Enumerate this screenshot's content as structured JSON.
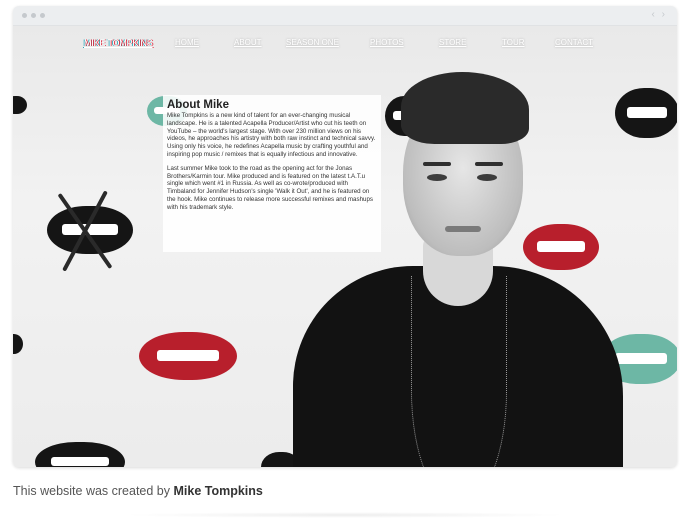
{
  "nav": {
    "logo": "MIKE TOMPKINS",
    "items": [
      "HOME",
      "ABOUT",
      "SEASON ONE",
      "PHOTOS",
      "STORE",
      "TOUR",
      "CONTACT"
    ]
  },
  "about": {
    "title": "About Mike",
    "paragraph1": "Mike Tompkins is a new kind of talent for an ever-changing musical landscape. He is a talented Acapella Producer/Artist who cut his teeth on YouTube – the world's largest stage. With over 230 million views on his videos, he approaches his artistry with both raw instinct and technical savvy. Using only his voice, he redefines Acapella music by crafting youthful and inspiring pop music / remixes that is equally infectious and innovative.",
    "paragraph2": "Last summer Mike took to the road as the opening act for the Jonas Brothers/Karmin tour. Mike produced and is featured on the latest t.A.T.u single which went #1 in Russia. As well as co-wrote/produced with Timbaland for Jennifer Hudson's single 'Walk it Out', and he is featured on the hook. Mike continues to release more successful remixes and mashups with his trademark style."
  },
  "footer": {
    "prefix": "This website was created by ",
    "author": "Mike Tompkins"
  },
  "colors": {
    "lip_red": "#b81f2c",
    "lip_teal": "#6db7a5",
    "lip_black": "#151515"
  }
}
